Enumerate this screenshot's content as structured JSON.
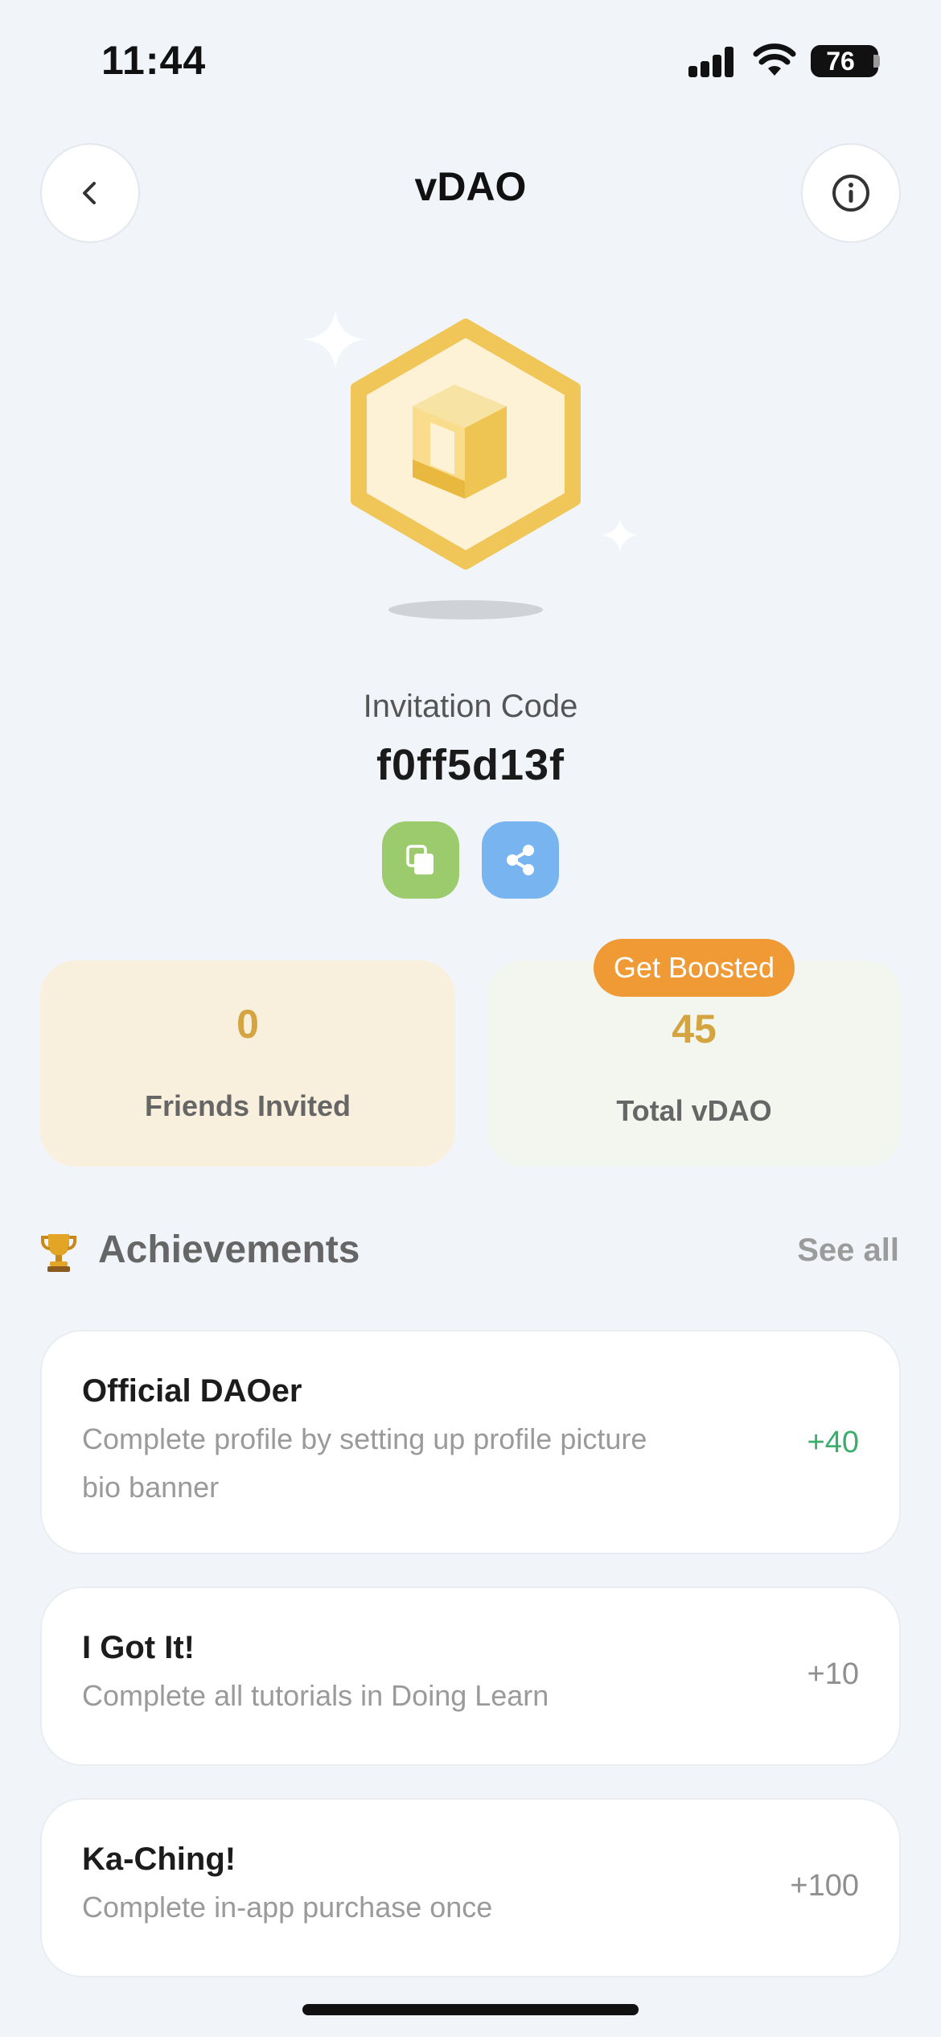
{
  "status_bar": {
    "time": "11:44",
    "battery": "76"
  },
  "header": {
    "title": "vDAO"
  },
  "invitation": {
    "label": "Invitation Code",
    "code": "f0ff5d13f"
  },
  "stats": {
    "friends_invited": {
      "value": "0",
      "label": "Friends Invited"
    },
    "total_vdao": {
      "value": "45",
      "label": "Total vDAO",
      "boost_label": "Get Boosted"
    }
  },
  "achievements": {
    "title": "Achievements",
    "see_all": "See all",
    "items": [
      {
        "name": "Official DAOer",
        "description": "Complete profile by setting up profile picture bio banner",
        "points": "+40",
        "earned": true
      },
      {
        "name": "I Got It!",
        "description": "Complete all tutorials in Doing Learn",
        "points": "+10",
        "earned": false
      },
      {
        "name": "Ka-Ching!",
        "description": "Complete in-app purchase once",
        "points": "+100",
        "earned": false
      }
    ]
  },
  "colors": {
    "background": "#f1f5fa",
    "accent_gold": "#d4a441",
    "boost_orange": "#ef9a35",
    "copy_green": "#9bcb6c",
    "share_blue": "#78b4f0",
    "earned_green": "#3cae6c"
  },
  "icons": {
    "back": "chevron-left-icon",
    "info": "info-icon",
    "copy": "copy-icon",
    "share": "share-icon",
    "trophy": "trophy-icon"
  }
}
